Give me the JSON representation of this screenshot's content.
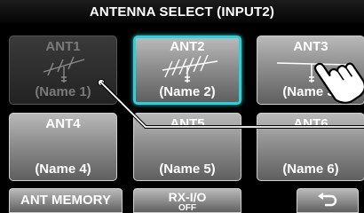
{
  "title": "ANTENNA SELECT (INPUT2)",
  "antennas": [
    {
      "name": "ANT1",
      "label": "(Name 1)"
    },
    {
      "name": "ANT2",
      "label": "(Name 2)"
    },
    {
      "name": "ANT3",
      "label": "(Name 3)"
    },
    {
      "name": "ANT4",
      "label": "(Name 4)"
    },
    {
      "name": "ANT5",
      "label": "(Name 5)"
    },
    {
      "name": "ANT6",
      "label": "(Name 6)"
    }
  ],
  "bottom": {
    "ant_memory": "ANT MEMORY",
    "rxio_label": "RX-I/O",
    "rxio_value": "OFF"
  },
  "icons": {
    "back": "return-arrow-icon",
    "pointer": "hand-pointer-icon"
  }
}
